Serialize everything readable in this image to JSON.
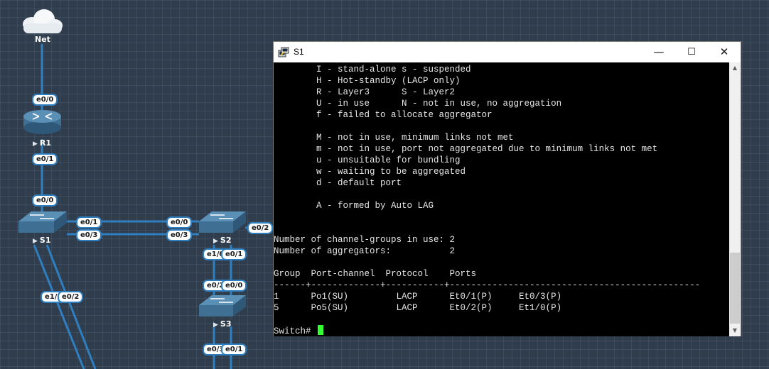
{
  "topology": {
    "nodes": {
      "net": {
        "label": "Net",
        "icon": "cloud-icon"
      },
      "r1": {
        "label": "R1",
        "icon": "router-icon"
      },
      "s1": {
        "label": "S1",
        "icon": "switch-icon"
      },
      "s2": {
        "label": "S2",
        "icon": "switch-icon"
      },
      "s3": {
        "label": "S3",
        "icon": "switch-icon"
      }
    },
    "ports": {
      "net_r1_e00": "e0/0",
      "r1_e01": "e0/1",
      "s1_e00": "e0/0",
      "s1_e01": "e0/1",
      "s1_e03": "e0/3",
      "s2_e00": "e0/0",
      "s2_e03": "e0/3",
      "s2_e02": "e0/2",
      "s2_e10": "e1/0",
      "s2_e01": "e0/1",
      "s3_e02": "e0/2",
      "s3_e00": "e0/0",
      "s3_e03": "e0/3",
      "s3_e01": "e0/1",
      "s1_e10": "e1/0",
      "s1_e02": "e0/2"
    },
    "link_color": "#2f7fc0"
  },
  "terminal": {
    "title": "S1",
    "controls": {
      "minimize": "—",
      "maximize": "☐",
      "close": "✕"
    },
    "lines": [
      "        I - stand-alone s - suspended",
      "        H - Hot-standby (LACP only)",
      "        R - Layer3      S - Layer2",
      "        U - in use      N - not in use, no aggregation",
      "        f - failed to allocate aggregator",
      "",
      "        M - not in use, minimum links not met",
      "        m - not in use, port not aggregated due to minimum links not met",
      "        u - unsuitable for bundling",
      "        w - waiting to be aggregated",
      "        d - default port",
      "",
      "        A - formed by Auto LAG",
      "",
      "",
      "Number of channel-groups in use: 2",
      "Number of aggregators:           2",
      "",
      "Group  Port-channel  Protocol    Ports",
      "------+-------------+-----------+-----------------------------------------------",
      "1      Po1(SU)         LACP      Et0/1(P)     Et0/3(P)",
      "5      Po5(SU)         LACP      Et0/2(P)     Et1/0(P)",
      "",
      "Switch# "
    ],
    "cursor_color": "#33ff33"
  }
}
